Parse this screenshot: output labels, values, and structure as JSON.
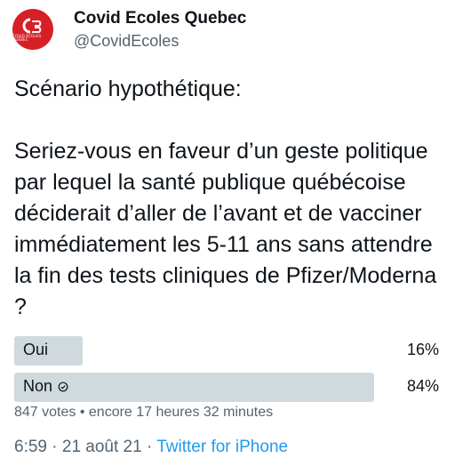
{
  "author": {
    "display_name": "Covid Ecoles Quebec",
    "handle": "@CovidEcoles",
    "avatar_text": "COVID ÉCOLES QUÉBEC",
    "avatar_color": "#d71f26"
  },
  "tweet": {
    "text": "Scénario hypothétique:\n\nSeriez-vous en faveur d’un geste politique par lequel la santé publique québécoise déciderait d’aller de l’avant et de vacciner immédiatement les 5-11 ans sans attendre la fin des tests cliniques de Pfizer/Moderna ?"
  },
  "poll": {
    "options": [
      {
        "label": "Oui",
        "percent": "16%",
        "fill_fraction": 0.16,
        "selected": false
      },
      {
        "label": "Non",
        "percent": "84%",
        "fill_fraction": 0.84,
        "selected": true
      }
    ],
    "votes": "847 votes",
    "separator": "•",
    "time_left": "encore 17 heures 32 minutes"
  },
  "meta": {
    "time": "6:59",
    "date": "21 août 21",
    "source": "Twitter for iPhone",
    "separator": "·"
  },
  "colors": {
    "text": "#0f1419",
    "secondary": "#536471",
    "link": "#1d9bf0",
    "poll_bar": "#cfd9de"
  }
}
